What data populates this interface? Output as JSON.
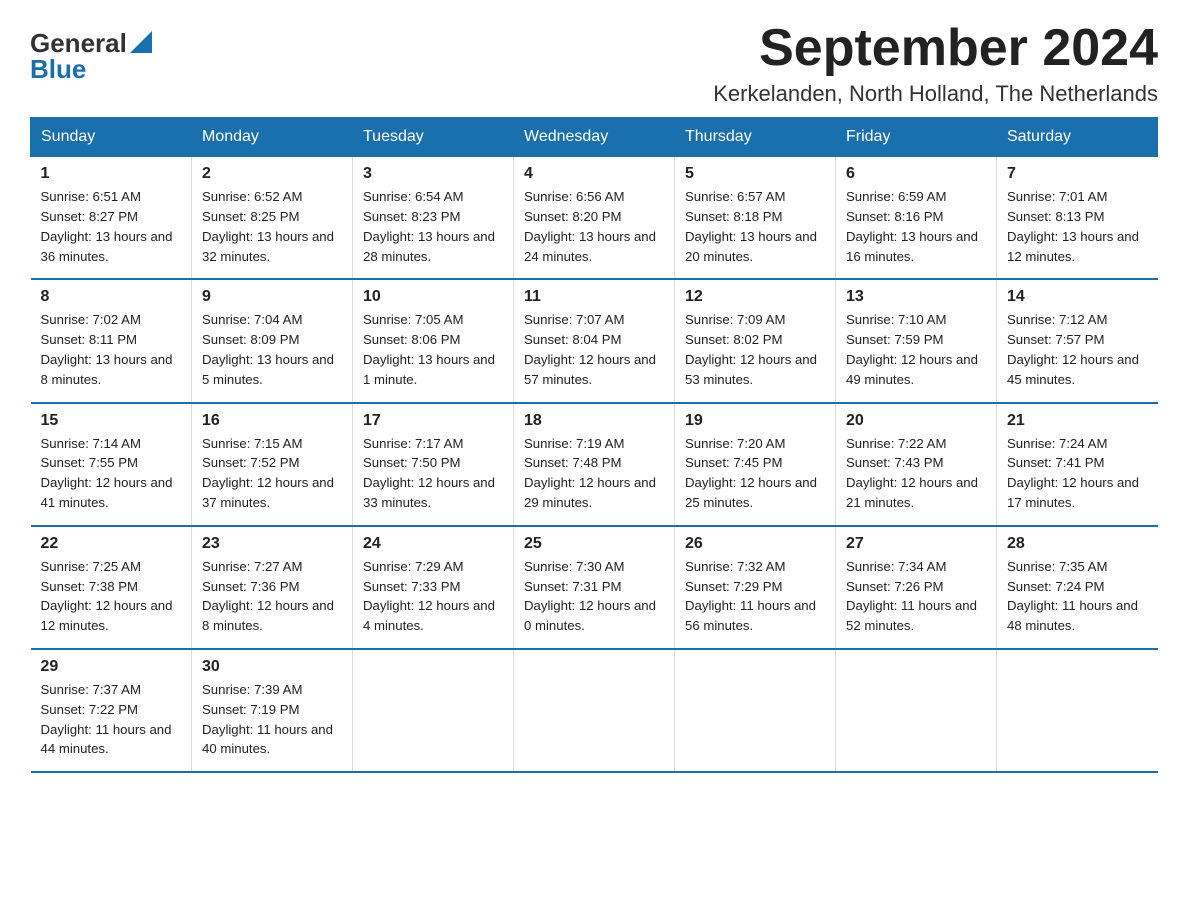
{
  "header": {
    "logo_general": "General",
    "logo_blue": "Blue",
    "title": "September 2024",
    "subtitle": "Kerkelanden, North Holland, The Netherlands"
  },
  "days_of_week": [
    "Sunday",
    "Monday",
    "Tuesday",
    "Wednesday",
    "Thursday",
    "Friday",
    "Saturday"
  ],
  "weeks": [
    [
      {
        "day": "1",
        "sunrise": "6:51 AM",
        "sunset": "8:27 PM",
        "daylight": "13 hours and 36 minutes."
      },
      {
        "day": "2",
        "sunrise": "6:52 AM",
        "sunset": "8:25 PM",
        "daylight": "13 hours and 32 minutes."
      },
      {
        "day": "3",
        "sunrise": "6:54 AM",
        "sunset": "8:23 PM",
        "daylight": "13 hours and 28 minutes."
      },
      {
        "day": "4",
        "sunrise": "6:56 AM",
        "sunset": "8:20 PM",
        "daylight": "13 hours and 24 minutes."
      },
      {
        "day": "5",
        "sunrise": "6:57 AM",
        "sunset": "8:18 PM",
        "daylight": "13 hours and 20 minutes."
      },
      {
        "day": "6",
        "sunrise": "6:59 AM",
        "sunset": "8:16 PM",
        "daylight": "13 hours and 16 minutes."
      },
      {
        "day": "7",
        "sunrise": "7:01 AM",
        "sunset": "8:13 PM",
        "daylight": "13 hours and 12 minutes."
      }
    ],
    [
      {
        "day": "8",
        "sunrise": "7:02 AM",
        "sunset": "8:11 PM",
        "daylight": "13 hours and 8 minutes."
      },
      {
        "day": "9",
        "sunrise": "7:04 AM",
        "sunset": "8:09 PM",
        "daylight": "13 hours and 5 minutes."
      },
      {
        "day": "10",
        "sunrise": "7:05 AM",
        "sunset": "8:06 PM",
        "daylight": "13 hours and 1 minute."
      },
      {
        "day": "11",
        "sunrise": "7:07 AM",
        "sunset": "8:04 PM",
        "daylight": "12 hours and 57 minutes."
      },
      {
        "day": "12",
        "sunrise": "7:09 AM",
        "sunset": "8:02 PM",
        "daylight": "12 hours and 53 minutes."
      },
      {
        "day": "13",
        "sunrise": "7:10 AM",
        "sunset": "7:59 PM",
        "daylight": "12 hours and 49 minutes."
      },
      {
        "day": "14",
        "sunrise": "7:12 AM",
        "sunset": "7:57 PM",
        "daylight": "12 hours and 45 minutes."
      }
    ],
    [
      {
        "day": "15",
        "sunrise": "7:14 AM",
        "sunset": "7:55 PM",
        "daylight": "12 hours and 41 minutes."
      },
      {
        "day": "16",
        "sunrise": "7:15 AM",
        "sunset": "7:52 PM",
        "daylight": "12 hours and 37 minutes."
      },
      {
        "day": "17",
        "sunrise": "7:17 AM",
        "sunset": "7:50 PM",
        "daylight": "12 hours and 33 minutes."
      },
      {
        "day": "18",
        "sunrise": "7:19 AM",
        "sunset": "7:48 PM",
        "daylight": "12 hours and 29 minutes."
      },
      {
        "day": "19",
        "sunrise": "7:20 AM",
        "sunset": "7:45 PM",
        "daylight": "12 hours and 25 minutes."
      },
      {
        "day": "20",
        "sunrise": "7:22 AM",
        "sunset": "7:43 PM",
        "daylight": "12 hours and 21 minutes."
      },
      {
        "day": "21",
        "sunrise": "7:24 AM",
        "sunset": "7:41 PM",
        "daylight": "12 hours and 17 minutes."
      }
    ],
    [
      {
        "day": "22",
        "sunrise": "7:25 AM",
        "sunset": "7:38 PM",
        "daylight": "12 hours and 12 minutes."
      },
      {
        "day": "23",
        "sunrise": "7:27 AM",
        "sunset": "7:36 PM",
        "daylight": "12 hours and 8 minutes."
      },
      {
        "day": "24",
        "sunrise": "7:29 AM",
        "sunset": "7:33 PM",
        "daylight": "12 hours and 4 minutes."
      },
      {
        "day": "25",
        "sunrise": "7:30 AM",
        "sunset": "7:31 PM",
        "daylight": "12 hours and 0 minutes."
      },
      {
        "day": "26",
        "sunrise": "7:32 AM",
        "sunset": "7:29 PM",
        "daylight": "11 hours and 56 minutes."
      },
      {
        "day": "27",
        "sunrise": "7:34 AM",
        "sunset": "7:26 PM",
        "daylight": "11 hours and 52 minutes."
      },
      {
        "day": "28",
        "sunrise": "7:35 AM",
        "sunset": "7:24 PM",
        "daylight": "11 hours and 48 minutes."
      }
    ],
    [
      {
        "day": "29",
        "sunrise": "7:37 AM",
        "sunset": "7:22 PM",
        "daylight": "11 hours and 44 minutes."
      },
      {
        "day": "30",
        "sunrise": "7:39 AM",
        "sunset": "7:19 PM",
        "daylight": "11 hours and 40 minutes."
      },
      null,
      null,
      null,
      null,
      null
    ]
  ],
  "labels": {
    "sunrise": "Sunrise:",
    "sunset": "Sunset:",
    "daylight": "Daylight:"
  }
}
